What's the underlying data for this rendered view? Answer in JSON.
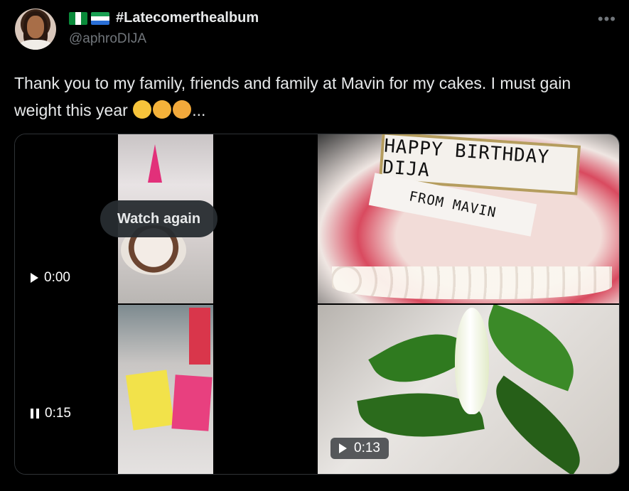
{
  "author": {
    "display_name": "#Latecomerthealbum",
    "handle": "@aphroDIJA",
    "flags": [
      "nigeria-flag-icon",
      "sierra-leone-flag-icon"
    ]
  },
  "tweet": {
    "text": "Thank you to my family, friends and family at Mavin for my cakes. I must gain weight this year",
    "emojis": [
      "rolling-on-floor-laughing-emoji",
      "hand-over-mouth-emoji",
      "astonished-emoji"
    ],
    "ellipsis": "..."
  },
  "media": {
    "video1": {
      "overlay_label": "Watch again",
      "time": "0:00",
      "state": "play-icon"
    },
    "photo_cake": {
      "sign_top": "HAPPY BIRTHDAY DIJA",
      "sign_bottom": "FROM MAVIN"
    },
    "video2": {
      "time": "0:15",
      "state": "pause-icon"
    },
    "video3": {
      "time": "0:13",
      "state": "play-icon"
    }
  },
  "colors": {
    "background": "#000000",
    "text": "#e7e9ea",
    "muted": "#71767b",
    "border": "#2f3336"
  }
}
